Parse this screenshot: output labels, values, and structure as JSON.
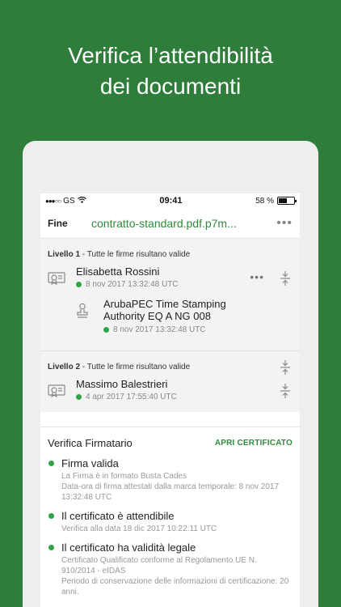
{
  "headline": {
    "line1": "Verifica l’attendibilità",
    "line2": "dei documenti"
  },
  "status": {
    "carrier": "GS",
    "time": "09:41",
    "battery": "58 %",
    "battery_level": 0.58
  },
  "nav": {
    "back_label": "Fine",
    "file_name": "contratto-standard.pdf.p7m...",
    "more_label": "•••"
  },
  "levels": [
    {
      "title": "Livello 1",
      "subtitle": " - Tutte le firme risultano valide",
      "signer": "Elisabetta Rossini",
      "date": "8 nov 2017 13:32:48 UTC",
      "timestamp": {
        "name": "ArubaPEC Time Stamping Authority EQ A NG 008",
        "date": "8 nov 2017 13:32:48 UTC"
      }
    },
    {
      "title": "Livello 2",
      "subtitle": " - Tutte le firme risultano valide",
      "signer": "Massimo Balestrieri",
      "date": "4 apr 2017 17:55:40 UTC"
    }
  ],
  "card": {
    "title": "Verifica Firmatario",
    "action": "APRI CERTIFICATO",
    "items": [
      {
        "title": "Firma valida",
        "desc": "La Firma è in formato Busta Cades\nData-ora di firma attestati dalla marca temporale: 8 nov 2017 13:32:48 UTC"
      },
      {
        "title": "Il certificato è attendibile",
        "desc": "Verifica alla data 18 dic 2017 10:22:11 UTC"
      },
      {
        "title": "Il certificato ha validità legale",
        "desc": "Certificato Qualificato conforme al Regolamento UE N. 910/2014 - eIDAS\nPeriodo di conservazione delle informazioni di certificazione: 20 anni."
      }
    ]
  },
  "colors": {
    "background": "#2f7d3a",
    "accent": "#2f8a3c",
    "valid_dot": "#2fa34a"
  },
  "icons": {
    "certificate": "certificate-icon",
    "stamp": "stamp-icon",
    "collapse": "collapse-icon",
    "wifi": "wifi-icon"
  }
}
